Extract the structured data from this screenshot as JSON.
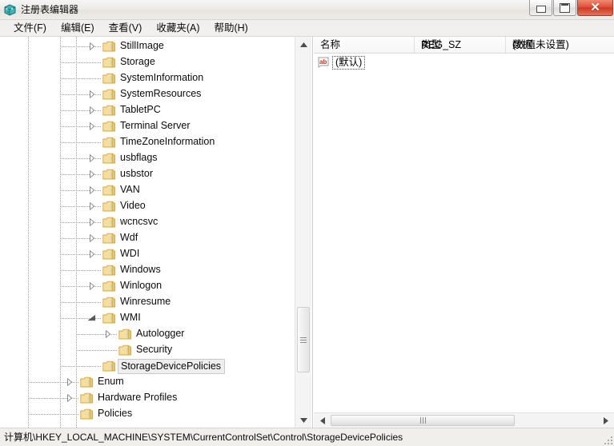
{
  "window": {
    "title": "注册表编辑器",
    "icon": "registry-editor-icon",
    "buttons": {
      "minimize": "minimize-icon",
      "maximize": "maximize-icon",
      "close": "✕"
    }
  },
  "menubar": {
    "items": [
      {
        "label": "文件(F)",
        "name": "menu-file"
      },
      {
        "label": "编辑(E)",
        "name": "menu-edit"
      },
      {
        "label": "查看(V)",
        "name": "menu-view"
      },
      {
        "label": "收藏夹(A)",
        "name": "menu-favorites"
      },
      {
        "label": "帮助(H)",
        "name": "menu-help"
      }
    ]
  },
  "tree": {
    "rows": [
      {
        "label": "StillImage",
        "indent": 2,
        "twisty": "collapsed",
        "selected": false
      },
      {
        "label": "Storage",
        "indent": 2,
        "twisty": "none",
        "selected": false
      },
      {
        "label": "SystemInformation",
        "indent": 2,
        "twisty": "none",
        "selected": false
      },
      {
        "label": "SystemResources",
        "indent": 2,
        "twisty": "collapsed",
        "selected": false
      },
      {
        "label": "TabletPC",
        "indent": 2,
        "twisty": "collapsed",
        "selected": false
      },
      {
        "label": "Terminal Server",
        "indent": 2,
        "twisty": "collapsed",
        "selected": false
      },
      {
        "label": "TimeZoneInformation",
        "indent": 2,
        "twisty": "none",
        "selected": false
      },
      {
        "label": "usbflags",
        "indent": 2,
        "twisty": "collapsed",
        "selected": false
      },
      {
        "label": "usbstor",
        "indent": 2,
        "twisty": "collapsed",
        "selected": false
      },
      {
        "label": "VAN",
        "indent": 2,
        "twisty": "collapsed",
        "selected": false
      },
      {
        "label": "Video",
        "indent": 2,
        "twisty": "collapsed",
        "selected": false
      },
      {
        "label": "wcncsvc",
        "indent": 2,
        "twisty": "collapsed",
        "selected": false
      },
      {
        "label": "Wdf",
        "indent": 2,
        "twisty": "collapsed",
        "selected": false
      },
      {
        "label": "WDI",
        "indent": 2,
        "twisty": "collapsed",
        "selected": false
      },
      {
        "label": "Windows",
        "indent": 2,
        "twisty": "none",
        "selected": false
      },
      {
        "label": "Winlogon",
        "indent": 2,
        "twisty": "collapsed",
        "selected": false
      },
      {
        "label": "Winresume",
        "indent": 2,
        "twisty": "none",
        "selected": false
      },
      {
        "label": "WMI",
        "indent": 2,
        "twisty": "expanded",
        "selected": false
      },
      {
        "label": "Autologger",
        "indent": 3,
        "twisty": "collapsed",
        "selected": false
      },
      {
        "label": "Security",
        "indent": 3,
        "twisty": "none",
        "selected": false
      },
      {
        "label": "StorageDevicePolicies",
        "indent": 2,
        "twisty": "none",
        "selected": true
      },
      {
        "label": "Enum",
        "indent": 1,
        "twisty": "collapsed",
        "selected": false
      },
      {
        "label": "Hardware Profiles",
        "indent": 1,
        "twisty": "collapsed",
        "selected": false
      },
      {
        "label": "Policies",
        "indent": 1,
        "twisty": "none",
        "selected": false
      }
    ]
  },
  "list": {
    "columns": [
      {
        "label": "名称",
        "name": "column-name"
      },
      {
        "label": "类型",
        "name": "column-type"
      },
      {
        "label": "数据",
        "name": "column-data"
      }
    ],
    "rows": [
      {
        "icon": "string-value-icon",
        "name": "(默认)",
        "type": "REG_SZ",
        "data": "(数值未设置)"
      }
    ]
  },
  "statusbar": {
    "path": "计算机\\HKEY_LOCAL_MACHINE\\SYSTEM\\CurrentControlSet\\Control\\StorageDevicePolicies"
  },
  "colors": {
    "accent_close": "#cf3a22",
    "folder": "#f0c878",
    "string_icon": "#c0392b",
    "selection": "#eeeeee"
  }
}
